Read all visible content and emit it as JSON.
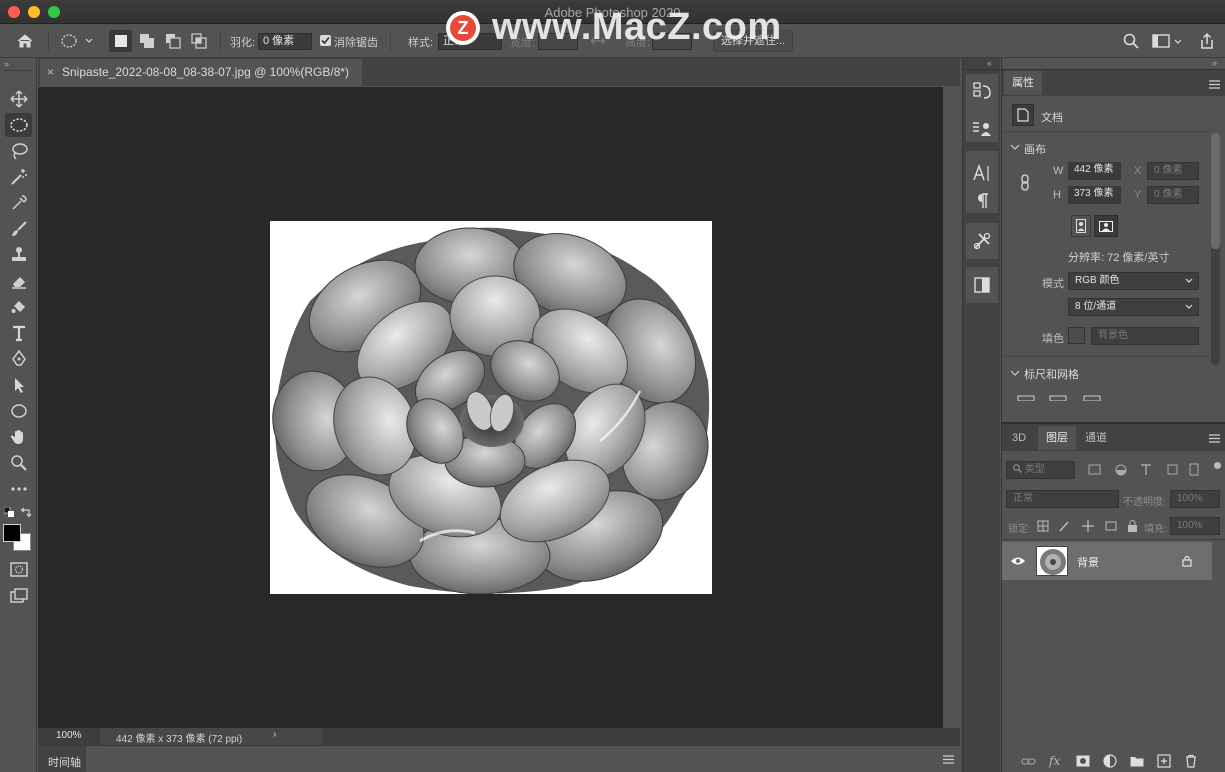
{
  "window": {
    "title": "Adobe Photoshop 2020"
  },
  "watermark": {
    "text": "www.MacZ.com",
    "badge": "Z"
  },
  "options_bar": {
    "feather_label": "羽化:",
    "feather_value": "0 像素",
    "antialias_label": "消除锯齿",
    "antialias_checked": true,
    "style_label": "样式:",
    "style_value": "正常",
    "width_label": "宽度:",
    "height_label": "高度:",
    "select_mask_button": "选择并遮住..."
  },
  "document": {
    "tab_title": "Snipaste_2022-08-08_08-38-07.jpg @ 100%(RGB/8*)",
    "close_glyph": "×"
  },
  "status": {
    "zoom": "100%",
    "info": "442 像素 x 373 像素 (72 ppi)",
    "arrow": "›"
  },
  "timeline": {
    "label": "时间轴"
  },
  "properties": {
    "tab": "属性",
    "doc_label": "文档",
    "canvas_section": "画布",
    "w_label": "W",
    "w_value": "442 像素",
    "h_label": "H",
    "h_value": "373 像素",
    "x_label": "X",
    "x_value": "0 像素",
    "y_label": "Y",
    "y_value": "0 像素",
    "resolution": "分辨率: 72 像素/英寸",
    "mode_label": "模式",
    "mode_value": "RGB 颜色",
    "depth_value": "8 位/通道",
    "fill_label": "填色",
    "fill_value": "背景色",
    "rulers_section": "标尺和网格"
  },
  "layers_panel": {
    "tabs": [
      "3D",
      "图层",
      "通道"
    ],
    "active_tab": "图层",
    "filter_placeholder": "类型",
    "blend_mode": "正常",
    "opacity_label": "不透明度:",
    "opacity_value": "100%",
    "lock_label": "锁定:",
    "fill_label": "填充:",
    "fill_value": "100%",
    "layers": [
      {
        "name": "背景",
        "visible": true,
        "locked": true
      }
    ]
  },
  "colors": {
    "app_bg": "#535353",
    "canvas_bg": "#282828",
    "panel_dark": "#424242",
    "accent_red": "#fc5f57",
    "accent_yellow": "#fdbc2e",
    "accent_green": "#33c748"
  }
}
